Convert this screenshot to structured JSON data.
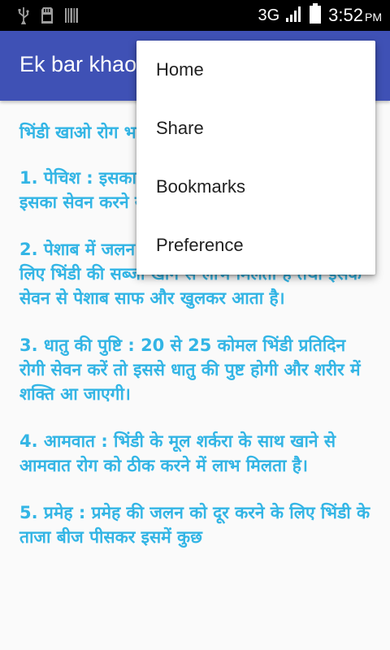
{
  "status_bar": {
    "network": "3G",
    "time": "3:52",
    "ampm": "PM",
    "icons": [
      "usb-icon",
      "sd-card-icon",
      "barcode-icon",
      "signal-icon",
      "battery-icon"
    ]
  },
  "app_bar": {
    "title": "Ek bar khao"
  },
  "content": {
    "heading": "भिंडी खाओ रोग भगाओ",
    "paragraphs": [
      "1. पेचिश : इसका सेवन पेचिश को दूर करती है तथा इसका सेवन करने से लाभ मिलता है।",
      "2. पेशाब में जलन : पेशाब की जलन को दूर करने के लिए भिंडी की सब्जी खाने से लाभ मिलता है तथा इसके सेवन से पेशाब साफ और खुलकर आता है।",
      "3. धातु की पुष्टि : 20 से 25 कोमल भिंडी प्रतिदिन रोगी सेवन करें तो इससे धातु की पुष्ट होगी और शरीर में शक्ति आ जाएगी।",
      "4. आमवात : भिंडी के मूल शर्करा के साथ खाने से आमवात रोग को ठीक करने में लाभ मिलता है।",
      "5. प्रमेह : प्रमेह की जलन को दूर करने के लिए भिंडी के ताजा बीज पीसकर इसमें कुछ"
    ],
    "text_color": "#33b5e5"
  },
  "menu": {
    "items": [
      "Home",
      "Share",
      "Bookmarks",
      "Preference"
    ]
  },
  "colors": {
    "app_bar": "#3f51b5",
    "status_bar": "#000000",
    "background": "#fafafa"
  }
}
